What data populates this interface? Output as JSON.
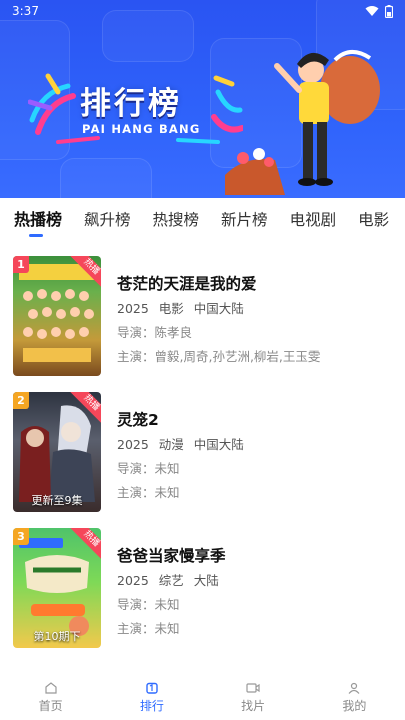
{
  "status_bar": {
    "time": "3:37"
  },
  "banner": {
    "title": "排行榜",
    "subtitle": "PAI HANG BANG"
  },
  "tabs": [
    {
      "label": "热播榜",
      "active": true
    },
    {
      "label": "飙升榜",
      "active": false
    },
    {
      "label": "热搜榜",
      "active": false
    },
    {
      "label": "新片榜",
      "active": false
    },
    {
      "label": "电视剧",
      "active": false
    },
    {
      "label": "电影",
      "active": false
    }
  ],
  "items": [
    {
      "rank": "1",
      "badge": "热播",
      "caption": "",
      "title": "苍茫的天涯是我的爱",
      "year": "2025",
      "genre": "电影",
      "region": "中国大陆",
      "director": "导演：陈孝良",
      "cast": "主演：曾毅,周奇,孙艺洲,柳岩,王玉雯",
      "rank_color": "#f5475a"
    },
    {
      "rank": "2",
      "badge": "热播",
      "caption": "更新至9集",
      "title": "灵笼2",
      "year": "2025",
      "genre": "动漫",
      "region": "中国大陆",
      "director": "导演：未知",
      "cast": "主演：未知",
      "rank_color": "#f5a623"
    },
    {
      "rank": "3",
      "badge": "热播",
      "caption": "第10期下",
      "title": "爸爸当家慢享季",
      "year": "2025",
      "genre": "综艺",
      "region": "大陆",
      "director": "导演：未知",
      "cast": "主演：未知",
      "rank_color": "#f5a623"
    }
  ],
  "bottom_nav": [
    {
      "label": "首页",
      "icon": "home-icon",
      "active": false
    },
    {
      "label": "排行",
      "icon": "ranking-icon",
      "active": true
    },
    {
      "label": "找片",
      "icon": "video-icon",
      "active": false
    },
    {
      "label": "我的",
      "icon": "user-icon",
      "active": false
    }
  ],
  "colors": {
    "accent": "#2f6bff",
    "banner": "#2f63fb",
    "hot": "#f5475a"
  }
}
